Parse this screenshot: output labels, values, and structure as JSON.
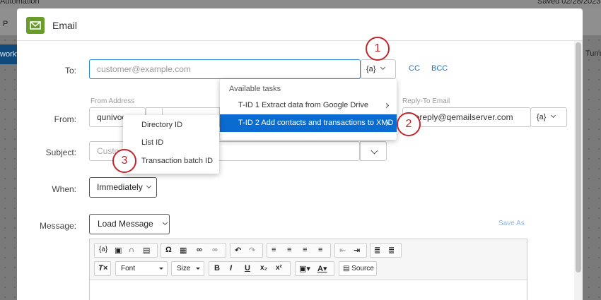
{
  "background": {
    "top_left": "Automation",
    "top_right": "Saved 02/28/2023",
    "nav_letter": "P",
    "left_button": "workf",
    "right_text": "Turn"
  },
  "modal": {
    "title": "Email",
    "icon": "envelope-icon",
    "accent": "#6a9c2c"
  },
  "form": {
    "to_label": "To:",
    "to_placeholder": "customer@example.com",
    "piped_text": "{a}",
    "cc": "CC",
    "bcc": "BCC",
    "from_label": "From:",
    "from_address_label": "From Address",
    "from_value": "qunivoc",
    "reply_to_label": "Reply-To Email",
    "reply_to_value": "noreply@qemailserver.com",
    "subject_label": "Subject:",
    "subject_placeholder": "Custo",
    "when_label": "When:",
    "when_value": "Immediately",
    "message_label": "Message:",
    "load_message": "Load Message",
    "save_as": "Save As"
  },
  "toolbar": {
    "font": "Font",
    "size": "Size",
    "source": "Source"
  },
  "tasks_menu": {
    "header": "Available tasks",
    "items": [
      "T-ID 1 Extract data from Google Drive",
      "T-ID 2 Add contacts and transactions to XMD"
    ],
    "selected_index": 1,
    "highlight": "#0a6bd1"
  },
  "ids_menu": {
    "items": [
      "Directory ID",
      "List ID",
      "Transaction batch ID"
    ]
  },
  "callouts": [
    "1",
    "2",
    "3"
  ],
  "callout_color": "#c0272d"
}
